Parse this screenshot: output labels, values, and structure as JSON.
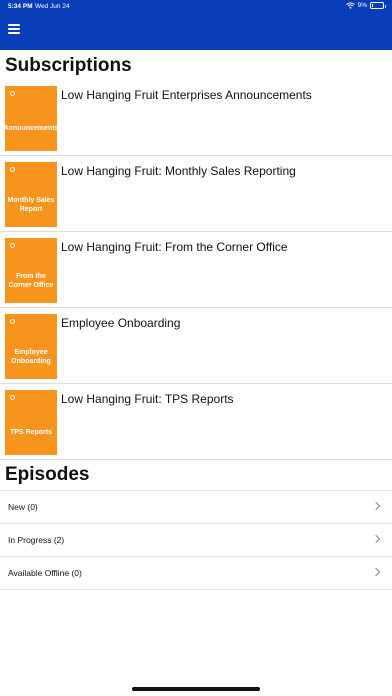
{
  "status_bar": {
    "time": "5:34 PM",
    "date": "Wed Jun 24",
    "battery": "9%",
    "battery_level": 0.09
  },
  "subscriptions": {
    "title": "Subscriptions",
    "items": [
      {
        "title": "Low Hanging Fruit Enterprises Announcements",
        "thumb_label": "Announcements"
      },
      {
        "title": "Low Hanging Fruit: Monthly Sales Reporting",
        "thumb_label": "Monthly Sales Report"
      },
      {
        "title": "Low Hanging Fruit: From the Corner Office",
        "thumb_label": "From the Corner Office"
      },
      {
        "title": "Employee Onboarding",
        "thumb_label": "Employee Onboarding"
      },
      {
        "title": "Low Hanging Fruit: TPS Reports",
        "thumb_label": "TPS Reports"
      }
    ]
  },
  "episodes": {
    "title": "Episodes",
    "rows": [
      {
        "label": "New (0)"
      },
      {
        "label": "In Progress (2)"
      },
      {
        "label": "Available Offline (0)"
      }
    ]
  },
  "colors": {
    "header": "#0a3eb8",
    "thumb": "#f7941d"
  },
  "icons": {
    "menu": "hamburger-menu-icon",
    "wifi": "wifi-icon",
    "battery": "battery-icon",
    "chevron": "chevron-right-icon"
  }
}
